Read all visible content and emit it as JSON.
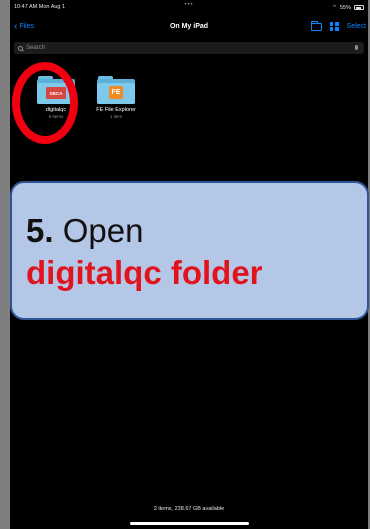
{
  "status": {
    "time": "10:47 AM  Mon Aug 1",
    "battery": "55%"
  },
  "nav": {
    "back_label": "Files",
    "title": "On My iPad",
    "select_label": "Select"
  },
  "search": {
    "placeholder": "Search"
  },
  "folders": [
    {
      "name": "digitalqc",
      "count": "6 items",
      "badge": "SBCA"
    },
    {
      "name": "FE File Explorer",
      "count": "1 item",
      "badge": "FE"
    }
  ],
  "footer": {
    "storage": "2 items, 238.67 GB available"
  },
  "callout": {
    "step": "5.",
    "text": "Open",
    "target": "digitalqc folder"
  },
  "colors": {
    "accent": "#0a84ff",
    "highlight": "#f00010",
    "callout_bg": "#b4c7e7",
    "callout_text": "#e1141e"
  }
}
